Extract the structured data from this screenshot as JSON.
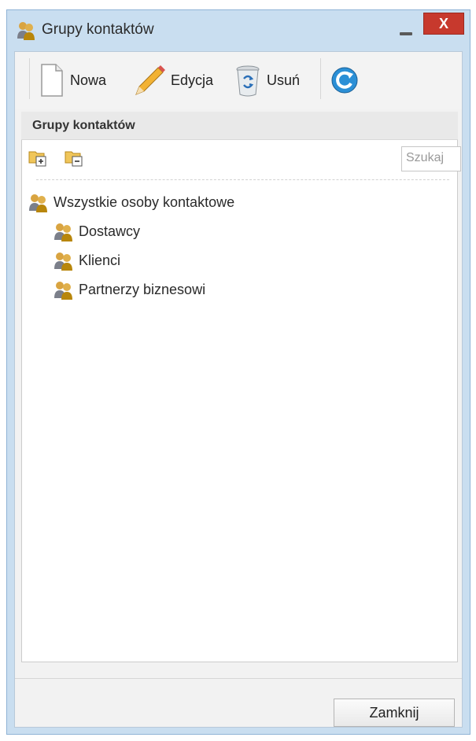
{
  "window": {
    "title": "Grupy kontaktów",
    "close_glyph": "X",
    "title_icon": "contact-group-icon"
  },
  "toolbar": {
    "new_label": "Nowa",
    "edit_label": "Edycja",
    "delete_label": "Usuń",
    "new_icon": "blank-page-icon",
    "edit_icon": "pencil-icon",
    "delete_icon": "recycle-bin-icon",
    "refresh_icon": "refresh-icon"
  },
  "panel": {
    "header": "Grupy kontaktów",
    "search_placeholder": "Szukaj",
    "expand_icon": "expand-all-folder-icon",
    "collapse_icon": "collapse-all-folder-icon"
  },
  "tree": {
    "root": "Wszystkie osoby kontaktowe",
    "children": [
      "Dostawcy",
      "Klienci",
      "Partnerzy biznesowi"
    ]
  },
  "footer": {
    "close_label": "Zamknij"
  },
  "colors": {
    "window_frame": "#c9def0",
    "close_button": "#c7392d",
    "client_bg": "#f2f2f2"
  }
}
